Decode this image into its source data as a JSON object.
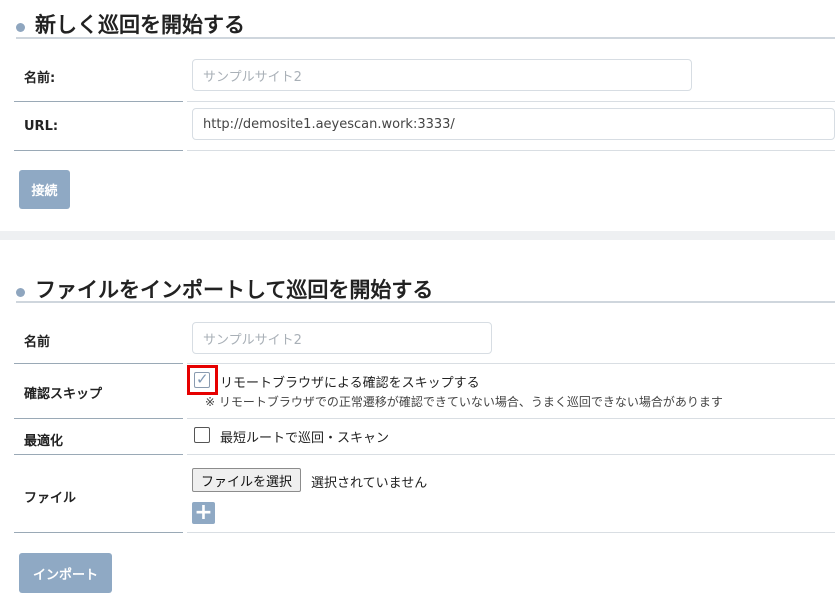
{
  "section1": {
    "title": "新しく巡回を開始する",
    "name_label": "名前:",
    "name_placeholder": "サンプルサイト2",
    "url_label": "URL:",
    "url_value": "http://demosite1.aeyescan.work:3333/",
    "connect_button": "接続"
  },
  "section2": {
    "title": "ファイルをインポートして巡回を開始する",
    "name_label": "名前",
    "name_placeholder": "サンプルサイト2",
    "skip_label": "確認スキップ",
    "skip_checkbox_text": "リモートブラウザによる確認をスキップする",
    "skip_checked": true,
    "skip_note": "※ リモートブラウザでの正常遷移が確認できていない場合、うまく巡回できない場合があります",
    "optimize_label": "最適化",
    "optimize_checkbox_text": "最短ルートで巡回・スキャン",
    "optimize_checked": false,
    "file_label": "ファイル",
    "file_button": "ファイルを選択",
    "file_status": "選択されていません",
    "import_button": "インポート"
  },
  "colors": {
    "accent": "#8fa9c4",
    "highlight": "#e60000"
  }
}
